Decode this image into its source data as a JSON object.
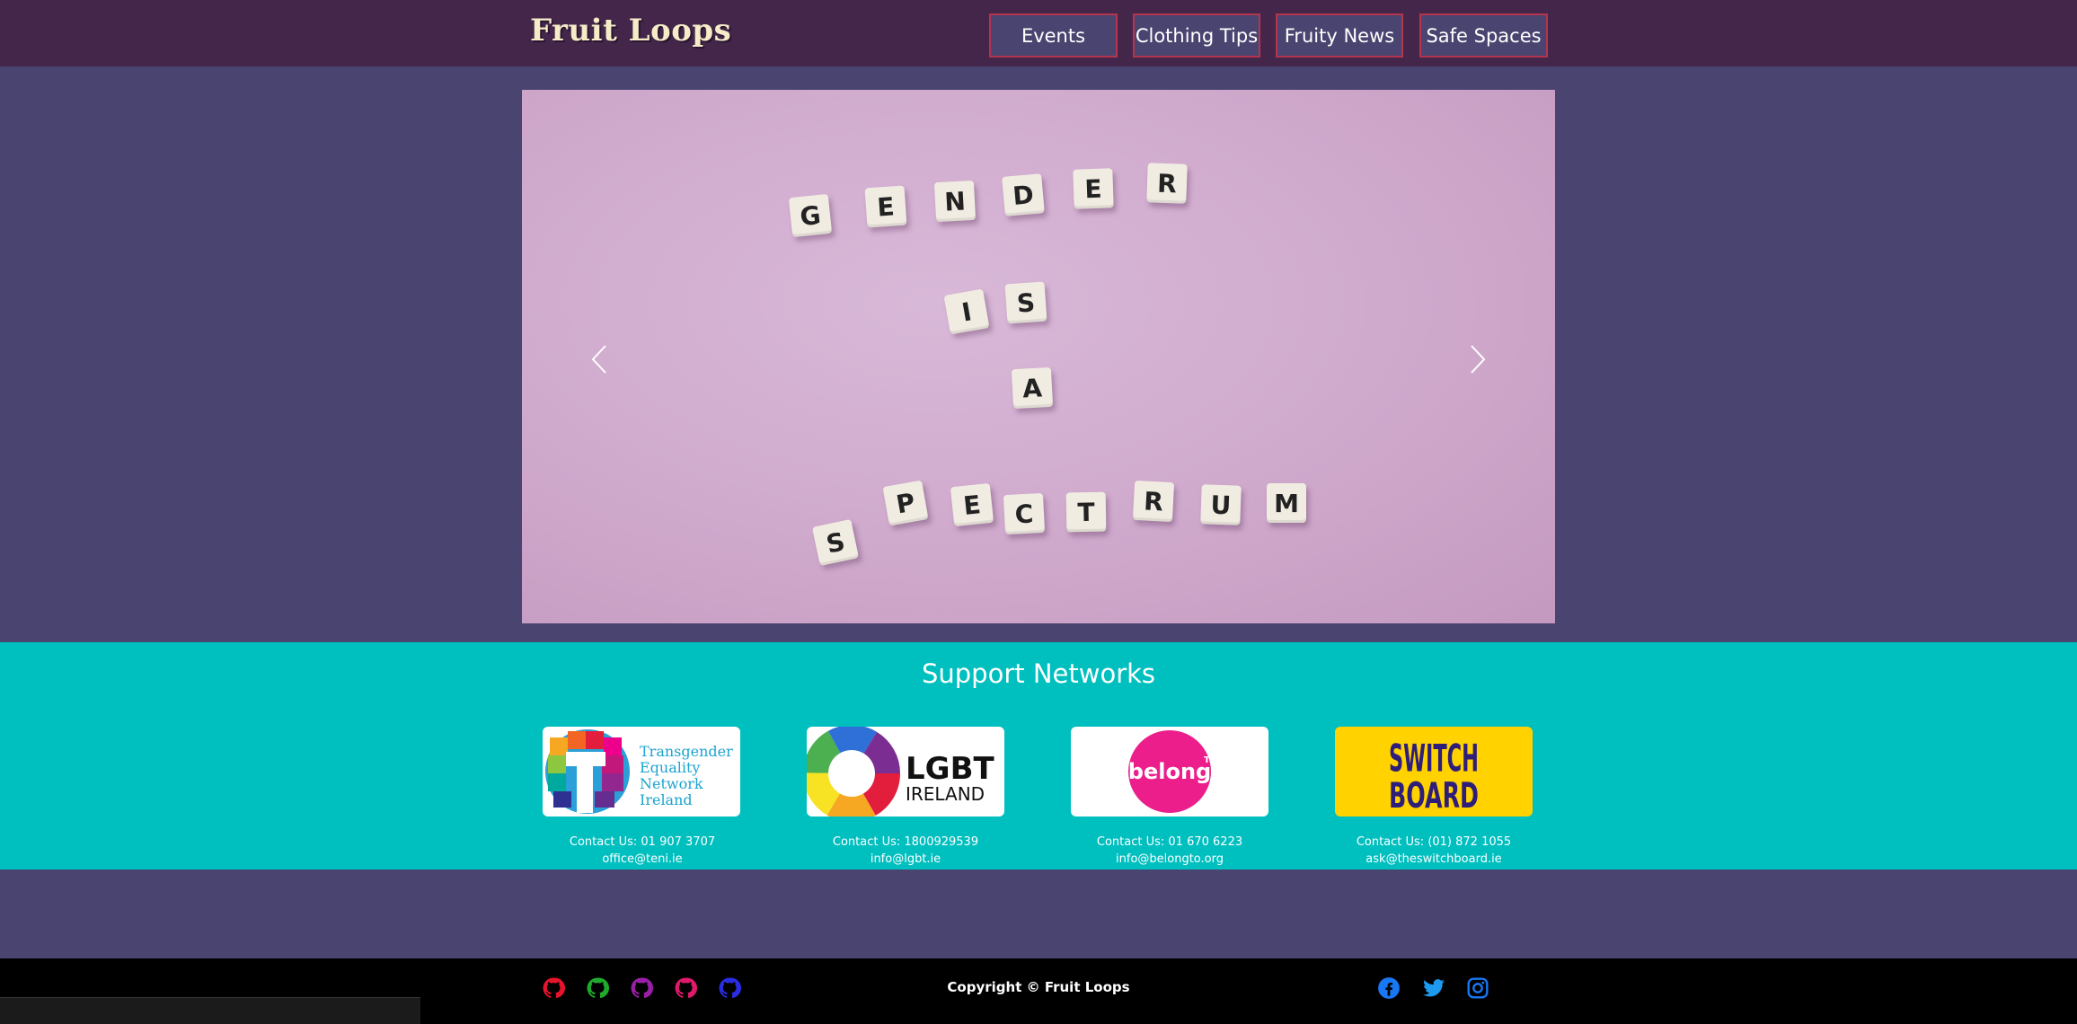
{
  "brand": {
    "name": "Fruit Loops"
  },
  "nav": [
    {
      "label": "Events"
    },
    {
      "label": "Clothing Tips"
    },
    {
      "label": "Fruity News"
    },
    {
      "label": "Safe Spaces"
    }
  ],
  "carousel": {
    "image_text": [
      "GENDER",
      "IS",
      "A",
      "SPECTRUM"
    ],
    "prev_icon": "chevron-left-icon",
    "next_icon": "chevron-right-icon"
  },
  "support": {
    "title": "Support Networks",
    "networks": [
      {
        "logo_text": [
          "Transgender",
          "Equality",
          "Network",
          "Ireland"
        ],
        "phone": "Contact Us: 01 907 3707",
        "email": "office@teni.ie"
      },
      {
        "logo_text": [
          "LGBT",
          "IRELAND"
        ],
        "phone": "Contact Us: 1800929539",
        "email": "info@lgbt.ie"
      },
      {
        "logo_text": [
          "belong",
          "TO"
        ],
        "phone": "Contact Us: 01 670 6223",
        "email": "info@belongto.org"
      },
      {
        "logo_text": [
          "SWITCH",
          "BOARD"
        ],
        "phone": "Contact Us: (01) 872 1055",
        "email": "ask@theswitchboard.ie"
      }
    ]
  },
  "footer": {
    "copyright": "Copyright © Fruit Loops",
    "github_icons": [
      {
        "icon": "github-icon",
        "color": "#e8132c"
      },
      {
        "icon": "github-icon",
        "color": "#1faa2c"
      },
      {
        "icon": "github-icon",
        "color": "#9a1fa8"
      },
      {
        "icon": "github-icon",
        "color": "#e01a6a"
      },
      {
        "icon": "github-icon",
        "color": "#2a2ce0"
      }
    ],
    "social_icons": [
      {
        "icon": "facebook-icon",
        "color": "#1877f2"
      },
      {
        "icon": "twitter-icon",
        "color": "#1d9bf0"
      },
      {
        "icon": "instagram-icon",
        "color": "#1877f2"
      }
    ]
  },
  "colors": {
    "navbar": "#43264a",
    "page": "#4a4470",
    "support": "#00bfbf",
    "nav_border": "#b5344e",
    "brand_text": "#f6edc8"
  }
}
